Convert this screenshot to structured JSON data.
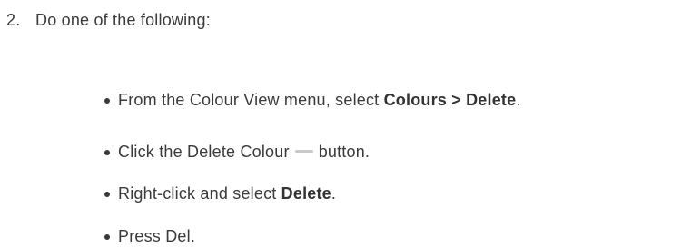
{
  "step": {
    "number": "2.",
    "intro": "Do one of the following:"
  },
  "options": [
    {
      "prefix": "From the Colour View menu, select ",
      "menu_path": "Colours > Delete",
      "suffix": "."
    },
    {
      "prefix": "Click the Delete Colour",
      "icon": "minus-icon",
      "suffix": "button."
    },
    {
      "prefix": "Right-click and select ",
      "command": "Delete",
      "suffix": "."
    },
    {
      "text": "Press Del."
    }
  ],
  "colors": {
    "text": "#3a3a3a",
    "icon": "#c9c9c9"
  }
}
